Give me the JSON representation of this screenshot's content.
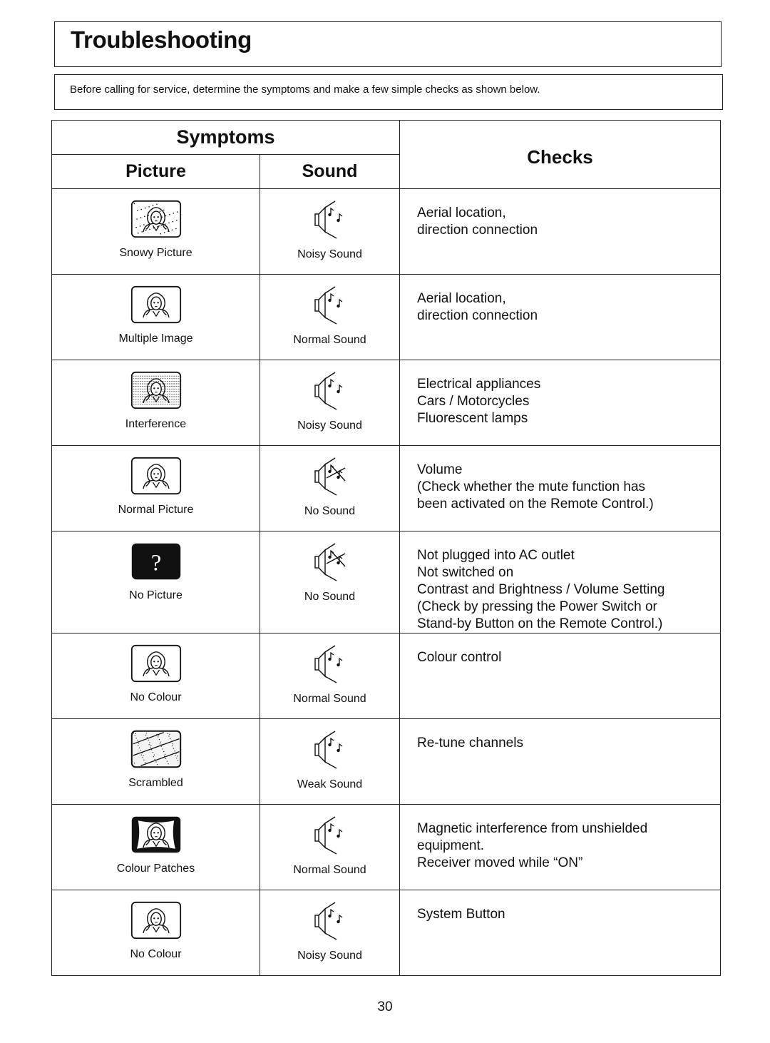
{
  "title": "Troubleshooting",
  "intro": "Before calling for service, determine the symptoms and make a few simple checks as shown below.",
  "table": {
    "symptoms_header": "Symptoms",
    "picture_header": "Picture",
    "sound_header": "Sound",
    "checks_header": "Checks",
    "rows": [
      {
        "picture": "Snowy Picture",
        "picture_icon": "snowy-picture-icon",
        "sound": "Noisy Sound",
        "sound_icon": "speaker-sound-icon",
        "checks": "Aerial location,\ndirection connection"
      },
      {
        "picture": "Multiple Image",
        "picture_icon": "multiple-image-icon",
        "sound": "Normal Sound",
        "sound_icon": "speaker-sound-icon",
        "checks": "Aerial location,\ndirection connection"
      },
      {
        "picture": "Interference",
        "picture_icon": "interference-picture-icon",
        "sound": "Noisy Sound",
        "sound_icon": "speaker-sound-icon",
        "checks": "Electrical appliances\nCars / Motorcycles\nFluorescent lamps"
      },
      {
        "picture": "Normal Picture",
        "picture_icon": "normal-picture-icon",
        "sound": "No Sound",
        "sound_icon": "speaker-muted-icon",
        "checks": "Volume\n(Check whether the mute function has\nbeen activated on the Remote Control.)"
      },
      {
        "picture": "No Picture",
        "picture_icon": "no-picture-icon",
        "sound": "No Sound",
        "sound_icon": "speaker-muted-icon",
        "checks": "Not plugged into AC outlet\nNot switched on\nContrast and Brightness / Volume Setting\n(Check by pressing the Power Switch or\nStand-by Button on the Remote Control.)"
      },
      {
        "picture": "No Colour",
        "picture_icon": "no-colour-picture-icon",
        "sound": "Normal Sound",
        "sound_icon": "speaker-sound-icon",
        "checks": "Colour control"
      },
      {
        "picture": "Scrambled",
        "picture_icon": "scrambled-picture-icon",
        "sound": "Weak Sound",
        "sound_icon": "speaker-sound-icon",
        "checks": "Re-tune channels"
      },
      {
        "picture": "Colour Patches",
        "picture_icon": "colour-patches-picture-icon",
        "sound": "Normal Sound",
        "sound_icon": "speaker-sound-icon",
        "checks": "Magnetic interference from unshielded\nequipment.\nReceiver moved while “ON”"
      },
      {
        "picture": "No Colour",
        "picture_icon": "no-colour-picture-icon",
        "sound": "Noisy Sound",
        "sound_icon": "speaker-sound-icon",
        "checks": "System Button"
      }
    ]
  },
  "no_picture_glyph": "?",
  "page_number": "30"
}
